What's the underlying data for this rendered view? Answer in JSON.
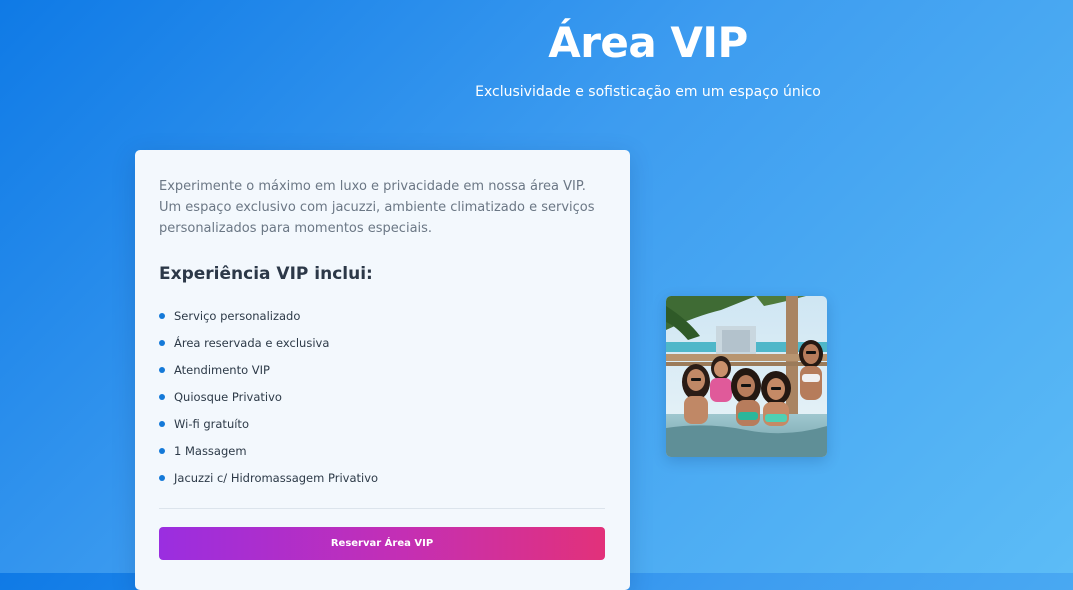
{
  "header": {
    "title": "Área VIP",
    "subtitle": "Exclusividade e sofisticação em um espaço único"
  },
  "card": {
    "description": "Experimente o máximo em luxo e privacidade em nossa área VIP. Um espaço exclusivo com jacuzzi, ambiente climatizado e serviços personalizados para momentos especiais.",
    "features_title": "Experiência VIP inclui:",
    "features": [
      {
        "label": "Serviço personalizado"
      },
      {
        "label": "Área reservada e exclusiva"
      },
      {
        "label": "Atendimento VIP"
      },
      {
        "label": "Quiosque Privativo"
      },
      {
        "label": "Wi-fi gratuíto"
      },
      {
        "label": "1 Massagem"
      },
      {
        "label": "Jacuzzi c/ Hidromassagem Privativo"
      }
    ],
    "button_label": "Reservar Área VIP"
  },
  "colors": {
    "background_start": "#0f7ae6",
    "background_end": "#5cbcf6",
    "card_background": "#f3f8fd",
    "bullet": "#1479d8",
    "button_start": "#9a2ee0",
    "button_end": "#e2317a"
  }
}
